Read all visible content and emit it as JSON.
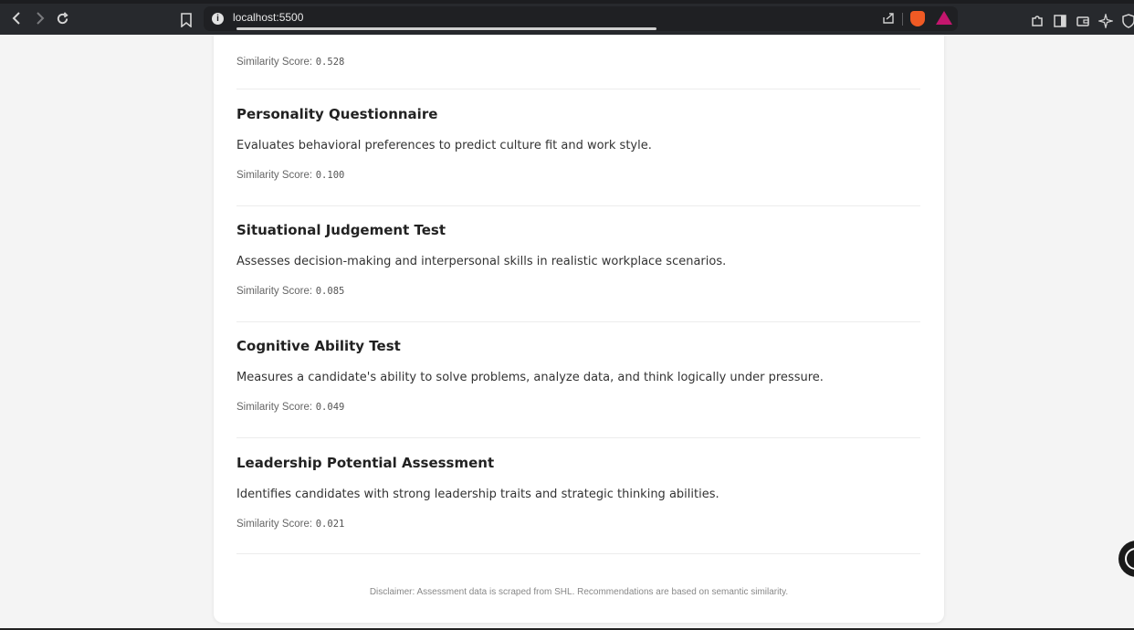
{
  "browser": {
    "url": "localhost:5500",
    "back_icon": "chevron-left",
    "forward_icon": "chevron-right",
    "reload_icon": "reload"
  },
  "results": [
    {
      "title": "",
      "description": "",
      "score_label": "Similarity Score:",
      "score": "0.528"
    },
    {
      "title": "Personality Questionnaire",
      "description": "Evaluates behavioral preferences to predict culture fit and work style.",
      "score_label": "Similarity Score:",
      "score": "0.100"
    },
    {
      "title": "Situational Judgement Test",
      "description": "Assesses decision-making and interpersonal skills in realistic workplace scenarios.",
      "score_label": "Similarity Score:",
      "score": "0.085"
    },
    {
      "title": "Cognitive Ability Test",
      "description": "Measures a candidate's ability to solve problems, analyze data, and think logically under pressure.",
      "score_label": "Similarity Score:",
      "score": "0.049"
    },
    {
      "title": "Leadership Potential Assessment",
      "description": "Identifies candidates with strong leadership traits and strategic thinking abilities.",
      "score_label": "Similarity Score:",
      "score": "0.021"
    }
  ],
  "disclaimer": "Disclaimer: Assessment data is scraped from SHL. Recommendations are based on semantic similarity."
}
